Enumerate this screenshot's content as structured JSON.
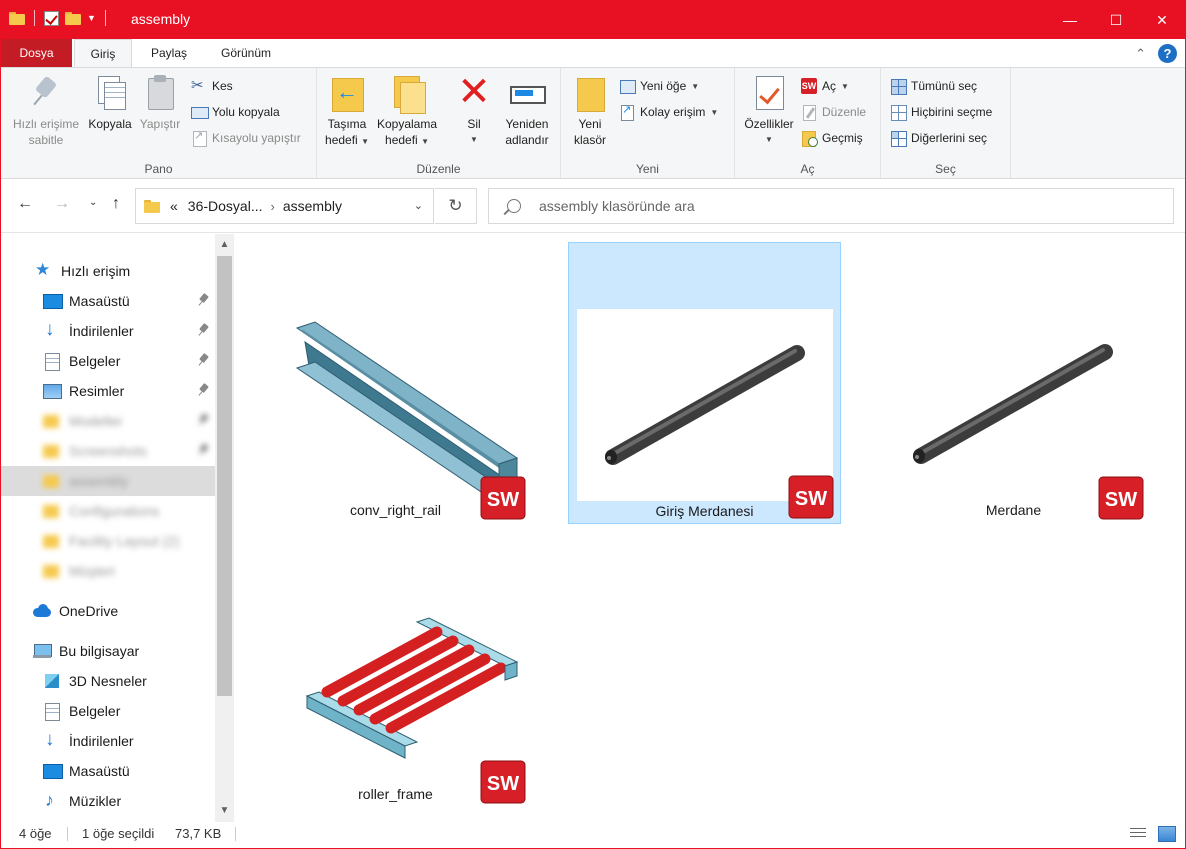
{
  "window": {
    "title": "assembly",
    "accent": "#e81123",
    "controls": {
      "minimize": "—",
      "maximize": "☐",
      "close": "✕"
    }
  },
  "tabs": {
    "file": "Dosya",
    "home": "Giriş",
    "share": "Paylaş",
    "view": "Görünüm"
  },
  "ribbon": {
    "clipboard": {
      "label": "Pano",
      "pin": [
        "Hızlı erişime",
        "sabitle"
      ],
      "copy": "Kopyala",
      "paste": "Yapıştır",
      "cut": "Kes",
      "copy_path": "Yolu kopyala",
      "paste_shortcut": "Kısayolu yapıştır"
    },
    "organize": {
      "label": "Düzenle",
      "move_to": [
        "Taşıma",
        "hedefi"
      ],
      "copy_to": [
        "Kopyalama",
        "hedefi"
      ],
      "delete": "Sil",
      "rename": [
        "Yeniden",
        "adlandır"
      ]
    },
    "new": {
      "label": "Yeni",
      "new_folder": [
        "Yeni",
        "klasör"
      ],
      "new_item": "Yeni öğe",
      "easy_access": "Kolay erişim"
    },
    "open": {
      "label": "Aç",
      "properties": "Özellikler",
      "open": "Aç",
      "edit": "Düzenle",
      "history": "Geçmiş",
      "sw_icon_text": "SW"
    },
    "select": {
      "label": "Seç",
      "select_all": "Tümünü seç",
      "select_none": "Hiçbirini seçme",
      "invert": "Diğerlerini seç"
    }
  },
  "address": {
    "prefix": "«",
    "crumbs": [
      "36-Dosyal...",
      "assembly"
    ],
    "separator": "›",
    "search_placeholder": "assembly klasöründe ara"
  },
  "nav": {
    "quick_access": "Hızlı erişim",
    "pinned": [
      {
        "label": "Masaüstü",
        "icon": "desktop-icon"
      },
      {
        "label": "İndirilenler",
        "icon": "download-icon"
      },
      {
        "label": "Belgeler",
        "icon": "documents-icon"
      },
      {
        "label": "Resimler",
        "icon": "pictures-icon"
      }
    ],
    "blurred": [
      "Modeller",
      "Screenshots",
      "assembly",
      "Configurations",
      "Facility Layout (2)",
      "Müşteri"
    ],
    "onedrive": "OneDrive",
    "this_pc": "Bu bilgisayar",
    "pc_items": [
      {
        "label": "3D Nesneler",
        "icon": "3d-objects-icon"
      },
      {
        "label": "Belgeler",
        "icon": "documents-icon"
      },
      {
        "label": "İndirilenler",
        "icon": "download-icon"
      },
      {
        "label": "Masaüstü",
        "icon": "desktop-icon"
      },
      {
        "label": "Müzikler",
        "icon": "music-icon"
      }
    ]
  },
  "files": [
    {
      "name": "conv_right_rail",
      "type": "rail",
      "selected": false
    },
    {
      "name": "Giriş Merdanesi",
      "type": "roller",
      "selected": true
    },
    {
      "name": "Merdane",
      "type": "roller",
      "selected": false
    },
    {
      "name": "roller_frame",
      "type": "frame",
      "selected": false
    }
  ],
  "sw_badge": "SW",
  "status": {
    "count": "4 öğe",
    "selection": "1 öğe seçildi",
    "size": "73,7 KB"
  }
}
